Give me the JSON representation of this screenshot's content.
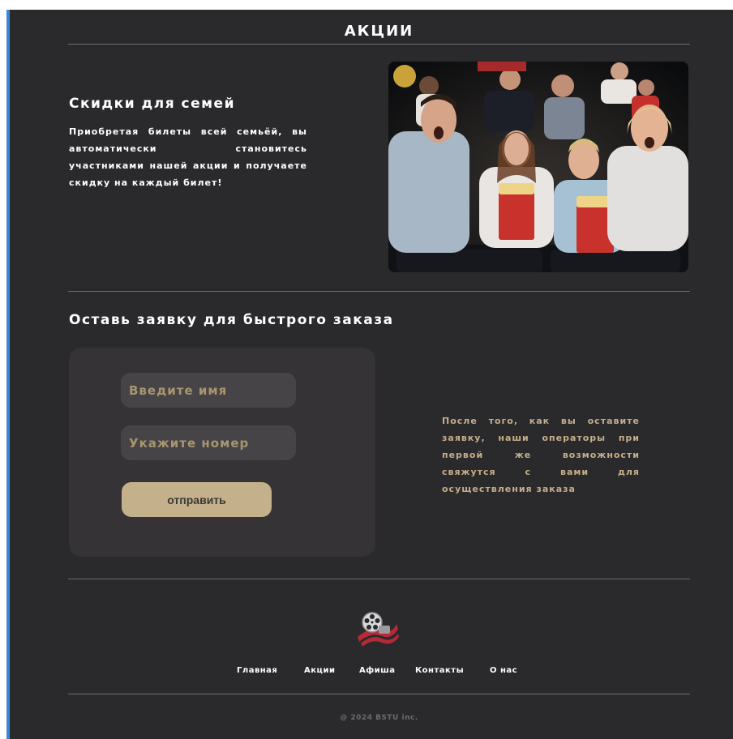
{
  "header": {
    "title": "АКЦИИ"
  },
  "promo": {
    "title": "Скидки для семей",
    "text": "Приобретая билеты всей семьёй, вы автоматически становитесь участниками нашей акции и получаете скидку на каждый билет!"
  },
  "form": {
    "title": "Оставь  заявку для быстрого заказа",
    "name_placeholder": "Введите имя",
    "phone_placeholder": "Укажите номер",
    "submit_label": "отправить",
    "note": "После того, как вы оставите заявку, наши операторы при первой же возможности свяжутся с вами для осуществления заказа"
  },
  "footer": {
    "nav": [
      {
        "label": "Главная"
      },
      {
        "label": "Акции"
      },
      {
        "label": "Афиша"
      },
      {
        "label": "Контакты"
      },
      {
        "label": "О нас"
      }
    ],
    "copyright": "@ 2024 BSTU inc."
  },
  "colors": {
    "background": "#2a292c",
    "card": "#353336",
    "accent": "#c4b08a",
    "divider": "#6d6c6f",
    "left_border": "#3b87d4"
  },
  "icons": {
    "logo": "film-reel-ribbon-icon"
  }
}
